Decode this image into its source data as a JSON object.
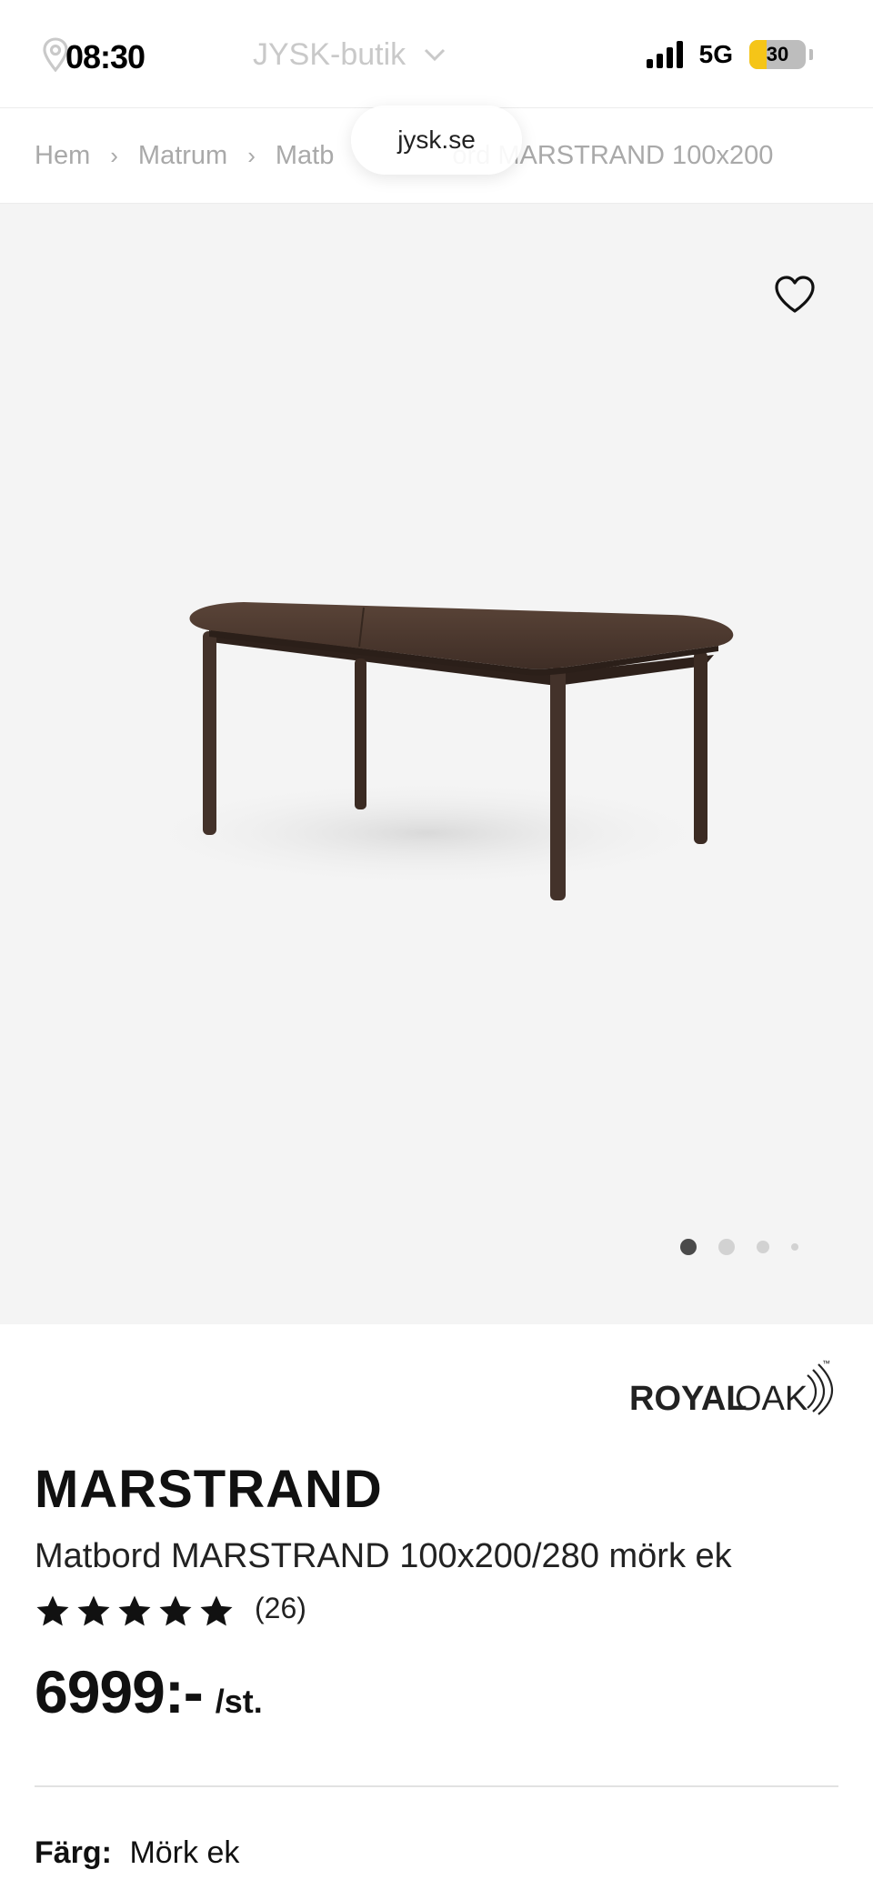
{
  "status_bar": {
    "time": "08:30",
    "network": "5G",
    "battery_percent": "30",
    "battery_level": 0.3,
    "signal_bars": 4
  },
  "store_picker": {
    "label": "JYSK-butik",
    "pin_icon": "location-pin-icon",
    "chevron_icon": "chevron-down-icon"
  },
  "browser": {
    "url": "jysk.se"
  },
  "breadcrumb": {
    "items": [
      "Hem",
      "Matrum",
      "Matb",
      "ord MARSTRAND 100x200"
    ]
  },
  "gallery": {
    "image_icon": "dining-table-image",
    "wishlist_icon": "heart-icon",
    "image_count": 4,
    "active_index": 0
  },
  "product": {
    "brand": "ROYAL OAK",
    "brand_part1": "ROYAL",
    "brand_part2": "OAK",
    "brand_tm": "™",
    "name": "MARSTRAND",
    "description": "Matbord MARSTRAND 100x200/280 mörk ek",
    "rating_stars": 5,
    "rating_count": "(26)",
    "price": "6999:-",
    "price_unit": "/st.",
    "color_label": "Färg:",
    "color_value": "Mörk ek"
  },
  "colors": {
    "text": "#111111",
    "muted": "#a9a9a9",
    "gallery_bg": "#f4f4f4",
    "table_wood": "#4a362c",
    "battery_fill": "#f5c518"
  }
}
